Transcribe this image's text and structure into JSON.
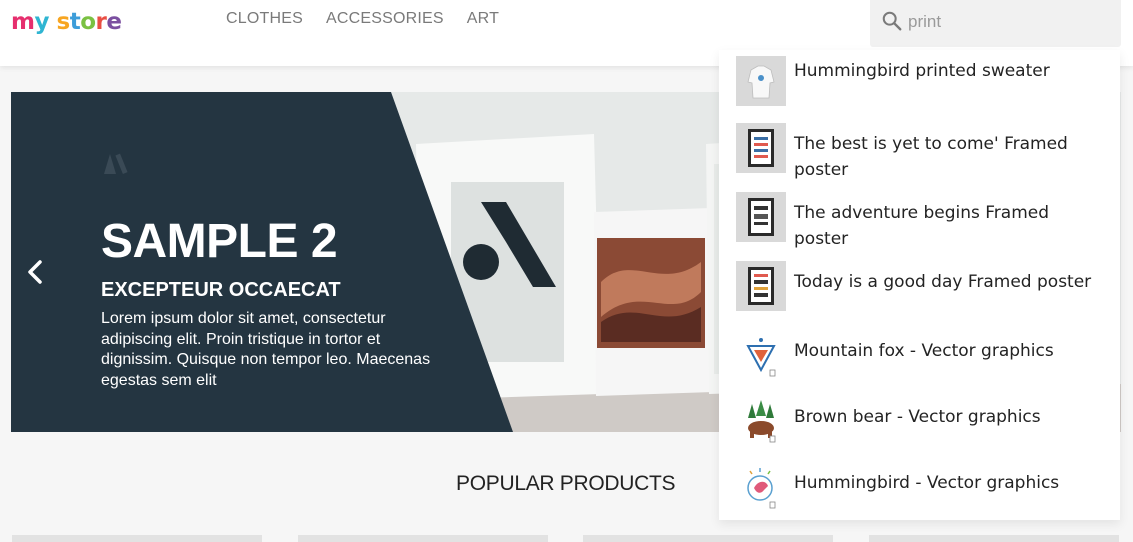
{
  "header": {
    "logo": {
      "part1": "my",
      "part2": "store"
    },
    "nav": [
      "CLOTHES",
      "ACCESSORIES",
      "ART"
    ],
    "search": {
      "value": "print",
      "icon": "search-icon"
    }
  },
  "carousel": {
    "title": "SAMPLE 2",
    "subtitle": "EXCEPTEUR OCCAECAT",
    "text": "Lorem ipsum dolor sit amet, consectetur adipiscing elit. Proin tristique in tortor et dignissim. Quisque non tempor leo. Maecenas egestas sem elit",
    "prev_icon": "chevron-left-icon"
  },
  "popular": {
    "title": "POPULAR PRODUCTS"
  },
  "search_results": [
    {
      "name": "Hummingbird printed sweater"
    },
    {
      "name": "The best is yet to come' Framed poster"
    },
    {
      "name": "The adventure begins Framed poster"
    },
    {
      "name": "Today is a good day Framed poster"
    },
    {
      "name": "Mountain fox - Vector graphics"
    },
    {
      "name": "Brown bear - Vector graphics"
    },
    {
      "name": "Hummingbird - Vector graphics"
    }
  ],
  "colors": {
    "panel": "#243541",
    "nav_text": "#7a7a7a",
    "search_bg": "#f1f1f1",
    "page_bg": "#f6f6f6"
  }
}
